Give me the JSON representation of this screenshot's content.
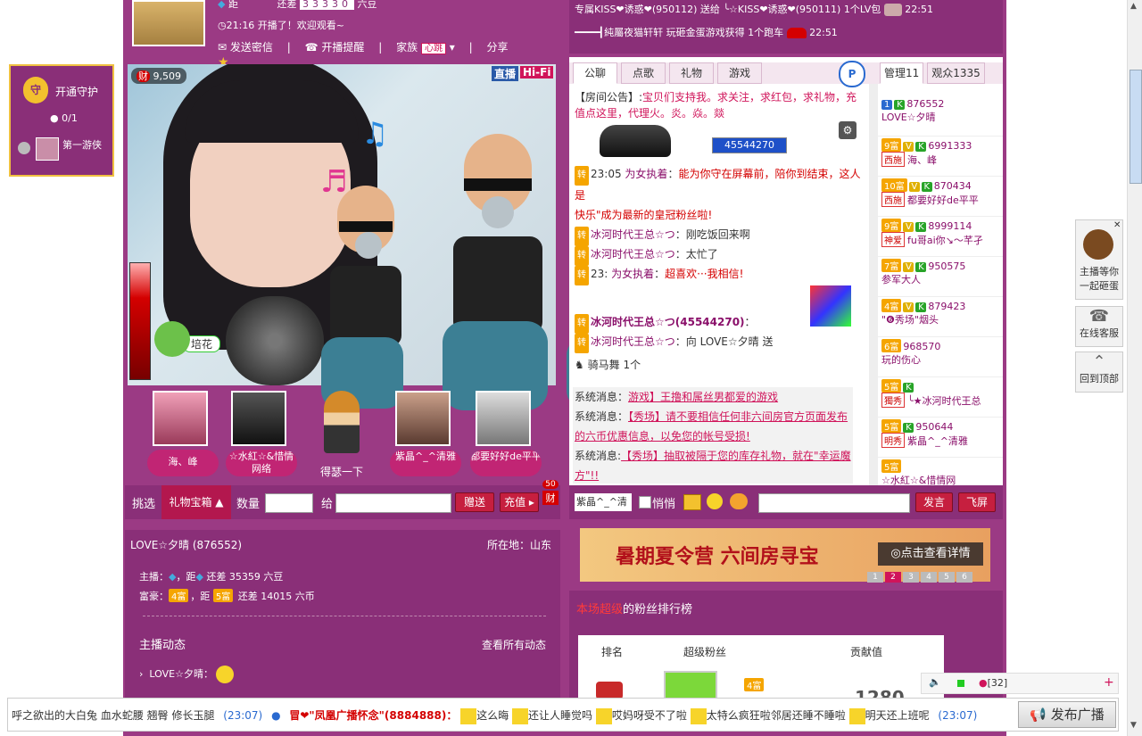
{
  "guard": {
    "label": "开通守护",
    "count": "0/1",
    "first": "第一游侠"
  },
  "header": {
    "line1_prefix": "距",
    "line1_mid": "还差",
    "line1_digits": "33330",
    "line1_suffix": "六豆",
    "time_line": "21:16 开播了！欢迎观看~",
    "send_msg": "发送密信",
    "live_remind": "开播提醒",
    "family": "家族",
    "family_badge": "心跳",
    "share": "分享"
  },
  "video": {
    "fortune": "9,509",
    "live_badge": "直播",
    "hifi_badge": "Hi-Fi",
    "flower_label": "培花"
  },
  "fans_thumbs": [
    {
      "label": "海、峰"
    },
    {
      "label": "☆水紅☆&惜情网络"
    },
    {
      "label": "得瑟一下"
    },
    {
      "label": "紫晶^_^清雅"
    },
    {
      "label": "都要好好de平平"
    }
  ],
  "gift_bar": {
    "pick": "挑选",
    "gift_box": "礼物宝箱",
    "quantity": "数量",
    "give_to": "给",
    "gift_btn": "赠送",
    "recharge_btn": "充值",
    "wealth_badge": "50",
    "wealth_char": "财"
  },
  "announce": [
    {
      "text": "专属KISS❤诱惑❤(950112) 送给 ╰☆KISS❤诱惑❤(950111) 1个LV包",
      "time": "22:51"
    },
    {
      "text": "━━━━┫純屬夜猫轩轩 玩砸金蛋游戏获得 1个跑车",
      "time": "22:51"
    }
  ],
  "chat_tabs": [
    "公聊",
    "点歌",
    "礼物",
    "游戏"
  ],
  "room_notice": {
    "label": "【房间公告】:",
    "text": "宝贝们支持我。求关注，求红包，求礼物，充值点这里，代理火。炎。焱。燚"
  },
  "room_number": "45544270",
  "chat_lines": [
    {
      "time": "23:05",
      "user": "为女执着",
      "msg": "能为你守在屏幕前，陪你到结束，这人是"
    },
    {
      "time": "",
      "user": "快乐",
      "msg": "\"成为最新的皇冠粉丝啦!"
    },
    {
      "time": "",
      "user": "冰河时代王总☆つ",
      "msg": "刚吃饭回来啊"
    },
    {
      "time": "",
      "user": "冰河时代王总☆つ",
      "msg": "太忙了"
    },
    {
      "time": "23:",
      "user": "为女执着",
      "msg": "超喜欢···我相信!"
    },
    {
      "time": "",
      "user": "冰河时代王总☆つ(45544270)",
      "msg": ""
    },
    {
      "time": "",
      "user": "冰河时代王总☆つ",
      "msg": "向 LOVE☆夕晴 送"
    },
    {
      "time": "",
      "user": "骑马舞",
      "msg": "1个"
    }
  ],
  "system_msgs": [
    {
      "label": "系统消息",
      "text": "游戏】王撸和属丝男都爱的游戏"
    },
    {
      "label": "系统消息",
      "text": "【秀场】请不要相信任何非六间房官方页面发布的六币优惠信息，以免您的帐号受损!"
    },
    {
      "label": "系统消息:",
      "text": "【秀场】抽取被隔于您的库存礼物，就在\"幸运魔方\"!!"
    }
  ],
  "chat_input": {
    "target": "紫晶^_^清",
    "quiet": "悄悄",
    "send": "发言",
    "fly": "飞屏"
  },
  "viewer_tabs": {
    "manage": "管理11",
    "audience": "观众1335"
  },
  "managers": [
    {
      "level": "1",
      "id": "876552",
      "name": "LOVE☆夕晴",
      "tag": "",
      "lv": ""
    },
    {
      "level": "9富",
      "id": "6991333",
      "name": "海、峰",
      "tag": "西施",
      "lv": "V"
    },
    {
      "level": "10富",
      "id": "870434",
      "name": "都要好好de平平",
      "tag": "西施",
      "lv": "V"
    },
    {
      "level": "9富",
      "id": "8999114",
      "name": "fu哥ai你↘～芊孑",
      "tag": "神爱",
      "lv": "V"
    },
    {
      "level": "7富",
      "id": "950575",
      "name": "参军大人",
      "tag": "",
      "lv": "V"
    },
    {
      "level": "4富",
      "id": "879423",
      "name": "\"❻秀场\"烟头",
      "tag": "",
      "lv": "V"
    },
    {
      "level": "6富",
      "id": "968570",
      "name": "玩的伤心",
      "tag": "",
      "lv": ""
    },
    {
      "level": "5富",
      "id": "",
      "name": "╰★冰河时代王总",
      "tag": "獨秀",
      "lv": ""
    },
    {
      "level": "5富",
      "id": "950644",
      "name": "紫晶^_^清雅",
      "tag": "明秀",
      "lv": ""
    },
    {
      "level": "5富",
      "id": "",
      "name": "☆水紅☆&惜情网",
      "tag": "",
      "lv": ""
    }
  ],
  "host": {
    "name_line": "LOVE☆夕晴 (876552)",
    "location": "所在地：山东",
    "anchor_label": "主播：",
    "anchor_mid": "，距",
    "anchor_remain": "还差 35359 六豆",
    "rich_label": "富豪：",
    "rich_level": "4富",
    "rich_next": "5富",
    "rich_remain": "还差 14015 六币",
    "dynamic_title": "主播动态",
    "view_all": "查看所有动态",
    "dynamic_item": "LOVE☆夕晴："
  },
  "banner": {
    "title": "暑期夏令营 六间房寻宝",
    "detail": "点击查看详情",
    "pages": [
      "1",
      "2",
      "3",
      "4",
      "5",
      "6"
    ],
    "active_page": "2"
  },
  "fan_rank": {
    "title_highlight": "本场超级",
    "title_rest": "的粉丝排行榜",
    "col_rank": "排名",
    "col_fan": "超级粉丝",
    "col_contrib": "贡献值",
    "first_value": "1280",
    "first_level": "4富"
  },
  "side_right": {
    "egg": "主播等你一起砸蛋",
    "service": "在线客服",
    "top": "回到顶部"
  },
  "ticker": {
    "text": "呼之欲出的大白兔 血水蛇腰 翘臀 修长玉腿",
    "time1": "(23:07)",
    "user": "冒❤\"凤凰广播怀念\"(8884888)：",
    "msgs": [
      "这么晦",
      "还让人睡觉吗",
      "哎妈呀受不了啦",
      "太特么疯狂啦邻居还睡不睡啦",
      "明天还上班呢"
    ],
    "time2": "(23:07)",
    "publish": "发布广播",
    "user_count": "[32]"
  },
  "colors": {
    "frame": "#9b3a84",
    "accent": "#d0145a",
    "button": "#c61f3f"
  }
}
